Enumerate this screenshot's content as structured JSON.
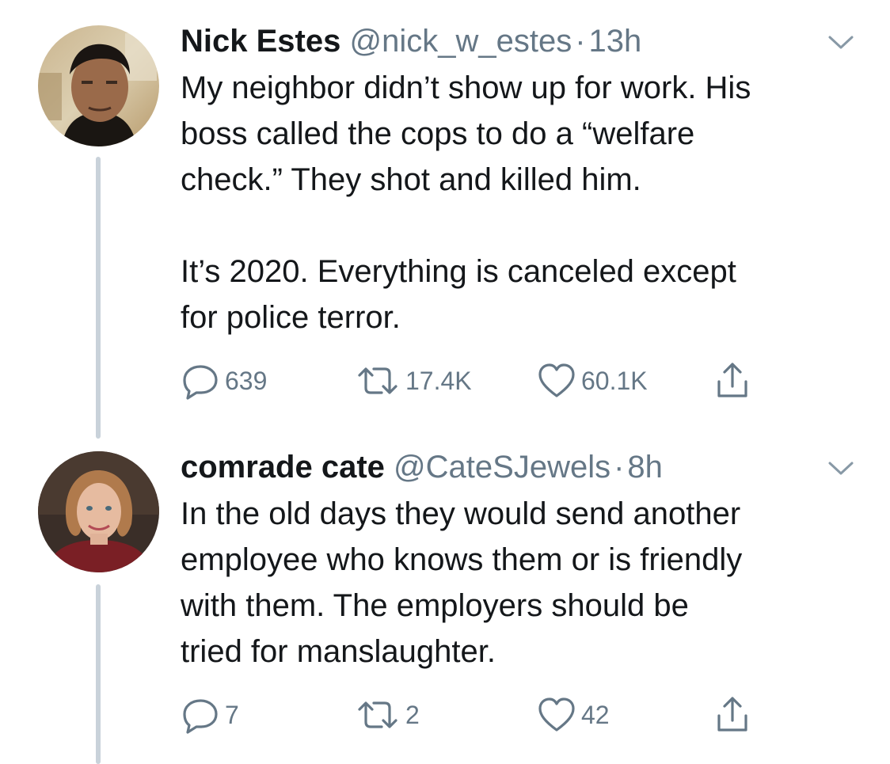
{
  "tweets": [
    {
      "display_name": "Nick Estes",
      "handle": "@nick_w_estes",
      "separator": "·",
      "time": "13h",
      "text_paragraphs": [
        "My neighbor didn’t show up for work. His\nboss called the cops to do a “welfare\ncheck.” They shot and killed him.",
        "It’s 2020. Everything is canceled except\nfor police terror."
      ],
      "replies": "639",
      "retweets": "17.4K",
      "likes": "60.1K"
    },
    {
      "display_name": "comrade cate",
      "handle": "@CateSJewels",
      "separator": "·",
      "time": "8h",
      "text_paragraphs": [
        "In the old days they would send another\nemployee who knows them or is friendly\nwith them. The employers should be\ntried for manslaughter."
      ],
      "replies": "7",
      "retweets": "2",
      "likes": "42"
    }
  ],
  "icons": {
    "reply": "reply-icon",
    "retweet": "retweet-icon",
    "like": "heart-icon",
    "share": "share-icon",
    "menu": "chevron-down-icon"
  },
  "colors": {
    "text": "#14171a",
    "secondary": "#657786",
    "thread_line": "#c9d2da"
  }
}
